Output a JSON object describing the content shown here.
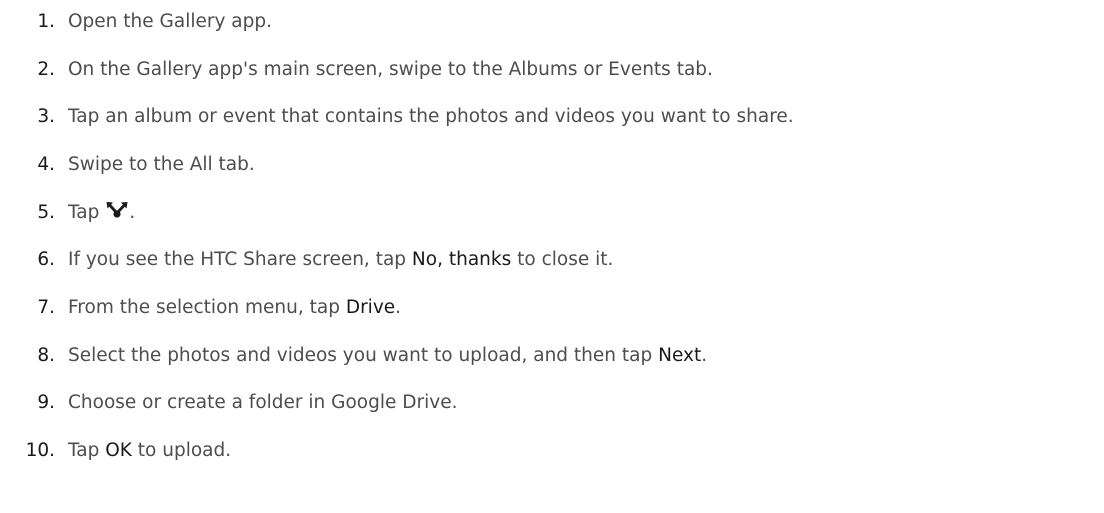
{
  "steps": [
    {
      "num": "1.",
      "before": "Open the Gallery app.",
      "em": "",
      "after": ""
    },
    {
      "num": "2.",
      "before": "On the Gallery app's main screen, swipe to the Albums or Events tab.",
      "em": "",
      "after": ""
    },
    {
      "num": "3.",
      "before": "Tap an album or event that contains the photos and videos you want to share.",
      "em": "",
      "after": ""
    },
    {
      "num": "4.",
      "before": "Swipe to the All tab.",
      "em": "",
      "after": ""
    },
    {
      "num": "5.",
      "before": "Tap",
      "em": "",
      "after": ".",
      "icon": "share-icon"
    },
    {
      "num": "6.",
      "before": "If you see the HTC Share screen, tap ",
      "em": "No, thanks",
      "after": " to close it."
    },
    {
      "num": "7.",
      "before": "From the selection menu, tap ",
      "em": "Drive",
      "after": "."
    },
    {
      "num": "8.",
      "before": "Select the photos and videos you want to upload, and then tap ",
      "em": "Next",
      "after": "."
    },
    {
      "num": "9.",
      "before": "Choose or create a folder in Google Drive.",
      "em": "",
      "after": ""
    },
    {
      "num": "10.",
      "before": "Tap ",
      "em": "OK",
      "after": " to upload."
    }
  ]
}
